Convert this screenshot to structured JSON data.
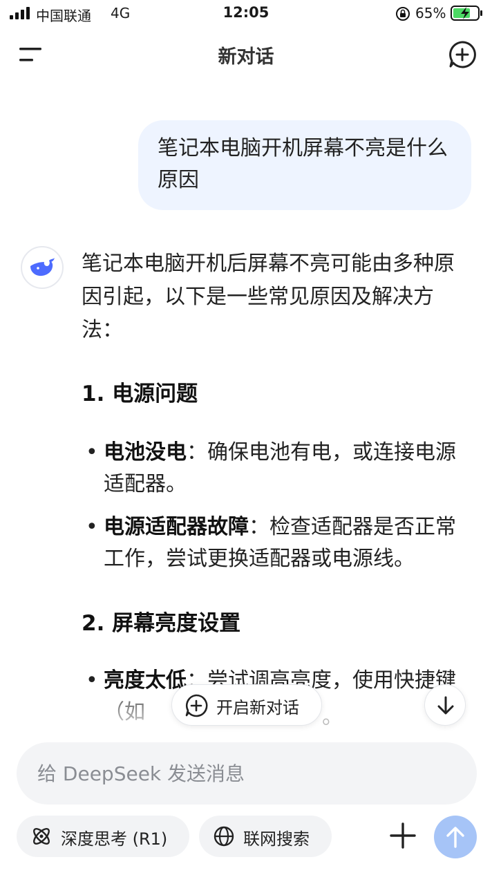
{
  "status_bar": {
    "carrier": "中国联通",
    "network": "4G",
    "time": "12:05",
    "battery_percent": "65%"
  },
  "nav": {
    "title": "新对话",
    "menu_icon": "menu-icon",
    "new_chat_icon": "new-chat-icon"
  },
  "user_message": "笔记本电脑开机屏幕不亮是什么原因",
  "assistant": {
    "intro": "笔记本电脑开机后屏幕不亮可能由多种原因引起，以下是一些常见原因及解决方法：",
    "sections": [
      {
        "heading": "1. 电源问题",
        "bullets": [
          {
            "title": "电池没电",
            "text": "：确保电池有电，或连接电源适配器。"
          },
          {
            "title": "电源适配器故障",
            "text": "：检查适配器是否正常工作，尝试更换适配器或电源线。"
          }
        ]
      },
      {
        "heading": "2. 屏幕亮度设置",
        "bullets": [
          {
            "title": "亮度太低",
            "text": "：尝试调高亮度，使用快捷键（如"
          }
        ]
      }
    ]
  },
  "floating": {
    "new_chat_label": "开启新对话",
    "partial_tail": "。"
  },
  "input": {
    "placeholder": "给 DeepSeek 发送消息"
  },
  "toolbar": {
    "deep_think_label": "深度思考 (R1)",
    "web_search_label": "联网搜索"
  },
  "colors": {
    "user_bubble": "#eef4ff",
    "send_button": "#a6c4f7",
    "brand": "#4d6bfe"
  }
}
